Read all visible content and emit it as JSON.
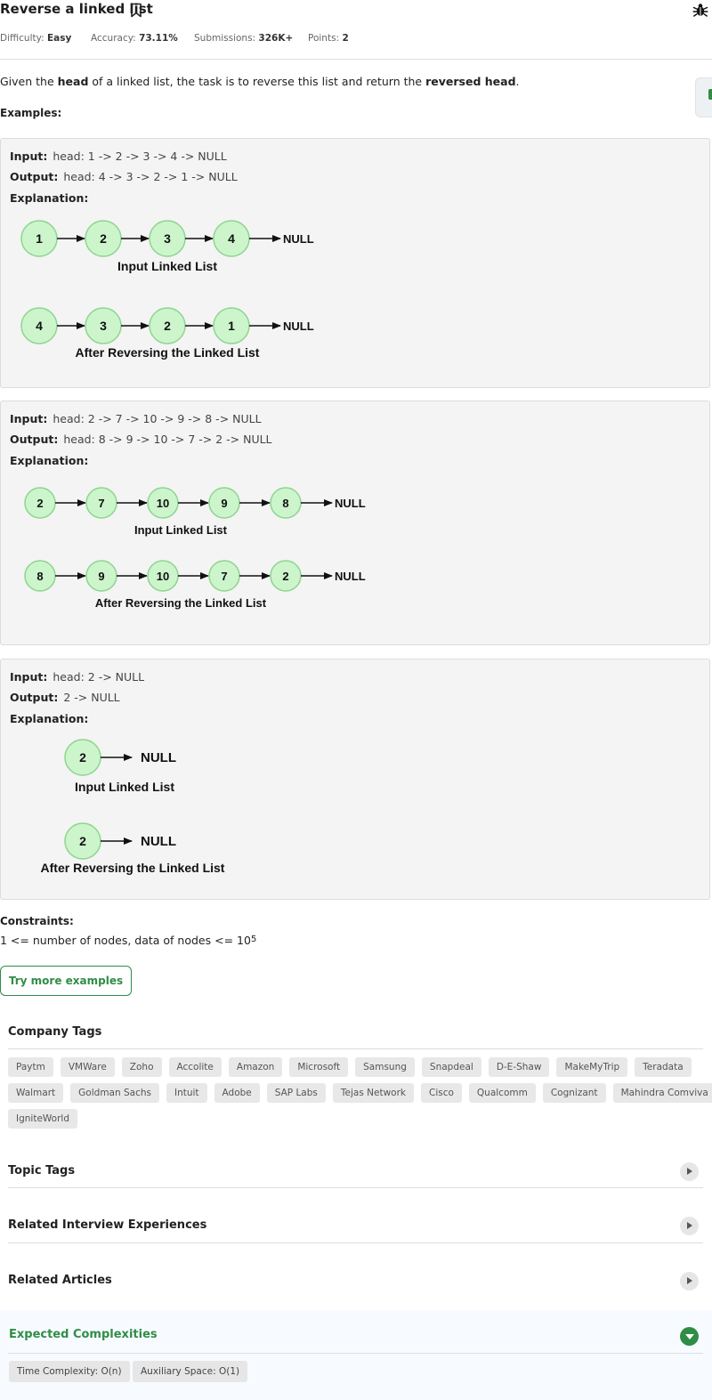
{
  "problem": {
    "title": "Reverse a linked list",
    "meta": {
      "difficulty_label": "Difficulty:",
      "difficulty_value": "Easy",
      "accuracy_label": "Accuracy:",
      "accuracy_value": "73.11%",
      "submissions_label": "Submissions:",
      "submissions_value": "326K+",
      "points_label": "Points:",
      "points_value": "2"
    },
    "description": {
      "p1": "Given the ",
      "b1": "head",
      "p2": " of a linked list, the task is to reverse this list and return the ",
      "b2": "reversed head",
      "p3": "."
    },
    "examples_label": "Examples:"
  },
  "examples": [
    {
      "input_label": "Input:",
      "input": "head:  1  ->  2  ->  3  ->  4  ->  NULL",
      "output_label": "Output:",
      "output": "head:  4  ->  3  ->  2  ->  1  ->  NULL",
      "explanation_label": "Explanation:",
      "input_nodes": [
        "1",
        "2",
        "3",
        "4"
      ],
      "output_nodes": [
        "4",
        "3",
        "2",
        "1"
      ],
      "null_label": "NULL",
      "input_caption": "Input Linked List",
      "output_caption": "After Reversing the Linked List"
    },
    {
      "input_label": "Input:",
      "input": "head:  2  ->  7  ->  10  ->  9  ->  8  ->  NULL",
      "output_label": "Output:",
      "output": "head:  8  ->  9  ->  10  ->  7  ->  2  ->  NULL",
      "explanation_label": "Explanation:",
      "input_nodes": [
        "2",
        "7",
        "10",
        "9",
        "8"
      ],
      "output_nodes": [
        "8",
        "9",
        "10",
        "7",
        "2"
      ],
      "null_label": "NULL",
      "input_caption": "Input Linked List",
      "output_caption": "After Reversing the Linked List"
    },
    {
      "input_label": "Input:",
      "input": "head:  2  ->  NULL",
      "output_label": "Output:",
      "output": "2  ->  NULL",
      "explanation_label": "Explanation:",
      "input_nodes": [
        "2"
      ],
      "output_nodes": [
        "2"
      ],
      "null_label": "NULL",
      "input_caption": "Input Linked List",
      "output_caption": "After Reversing the Linked List"
    }
  ],
  "constraints": {
    "label": "Constraints:",
    "text": "1 <= number of nodes, data of nodes <= 10",
    "exponent": "5"
  },
  "try_button": "Try more examples",
  "company_tags": {
    "title": "Company Tags",
    "items": [
      "Paytm",
      "VMWare",
      "Zoho",
      "Accolite",
      "Amazon",
      "Microsoft",
      "Samsung",
      "Snapdeal",
      "D-E-Shaw",
      "MakeMyTrip",
      "Teradata",
      "Walmart",
      "Goldman Sachs",
      "Intuit",
      "Adobe",
      "SAP Labs",
      "Tejas Network",
      "Cisco",
      "Qualcomm",
      "Cognizant",
      "Mahindra Comviva",
      "IgniteWorld"
    ]
  },
  "sections": {
    "topic_tags": "Topic Tags",
    "interview_experiences": "Related Interview Experiences",
    "related_articles": "Related Articles",
    "expected_complexities": "Expected Complexities"
  },
  "complexities": {
    "time": "Time Complexity: O(n)",
    "space": "Auxiliary Space: O(1)"
  },
  "colors": {
    "accent_green": "#2f8d46",
    "node_fill": "#ccf5cc",
    "node_stroke": "#8fd48f"
  },
  "icons": {
    "bookmark": "bookmark-icon",
    "bug": "bug-icon",
    "expand": "chevron-right-icon",
    "collapse": "chevron-down-icon"
  }
}
